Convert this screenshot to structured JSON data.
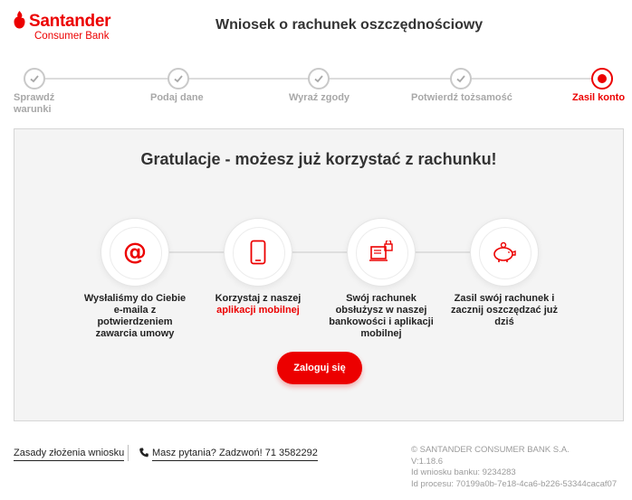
{
  "brand": {
    "name": "Santander",
    "sub": "Consumer Bank",
    "color": "#ec0000"
  },
  "header": {
    "title": "Wniosek o rachunek oszczędnościowy"
  },
  "stepper": {
    "steps": [
      {
        "label_line1": "Sprawdź",
        "label_line2": "warunki",
        "state": "done"
      },
      {
        "label_line1": "Podaj dane",
        "label_line2": "",
        "state": "done"
      },
      {
        "label_line1": "Wyraź zgody",
        "label_line2": "",
        "state": "done"
      },
      {
        "label_line1": "Potwierdź tożsamość",
        "label_line2": "",
        "state": "done"
      },
      {
        "label_line1": "Zasil konto",
        "label_line2": "",
        "state": "active"
      }
    ]
  },
  "main": {
    "title": "Gratulacje - możesz już korzystać z rachunku!",
    "features": [
      {
        "icon": "at-icon",
        "lines": [
          "Wysłaliśmy do Ciebie",
          "e-maila z",
          "potwierdzeniem",
          "zawarcia umowy"
        ]
      },
      {
        "icon": "smartphone-icon",
        "line1": "Korzystaj z naszej",
        "line2_red": "aplikacji mobilnej"
      },
      {
        "icon": "online-banking-icon",
        "lines": [
          "Swój rachunek",
          "obsłużysz w naszej",
          "bankowości i aplikacji",
          "mobilnej"
        ]
      },
      {
        "icon": "piggy-bank-icon",
        "lines": [
          "Zasil swój rachunek i",
          "zacznij oszczędzać już",
          "dziś"
        ]
      }
    ],
    "login_button": "Zaloguj się"
  },
  "footer": {
    "rules_link": "Zasady złożenia wniosku",
    "phone_link": "Masz pytania? Zadzwoń! 71 3582292",
    "copyright": "© SANTANDER CONSUMER BANK S.A.",
    "version": "V:1.18.6",
    "application_id": "Id wniosku banku: 9234283",
    "process_id": "Id procesu: 70199a0b-7e18-4ca6-b226-53344cacaf07"
  }
}
